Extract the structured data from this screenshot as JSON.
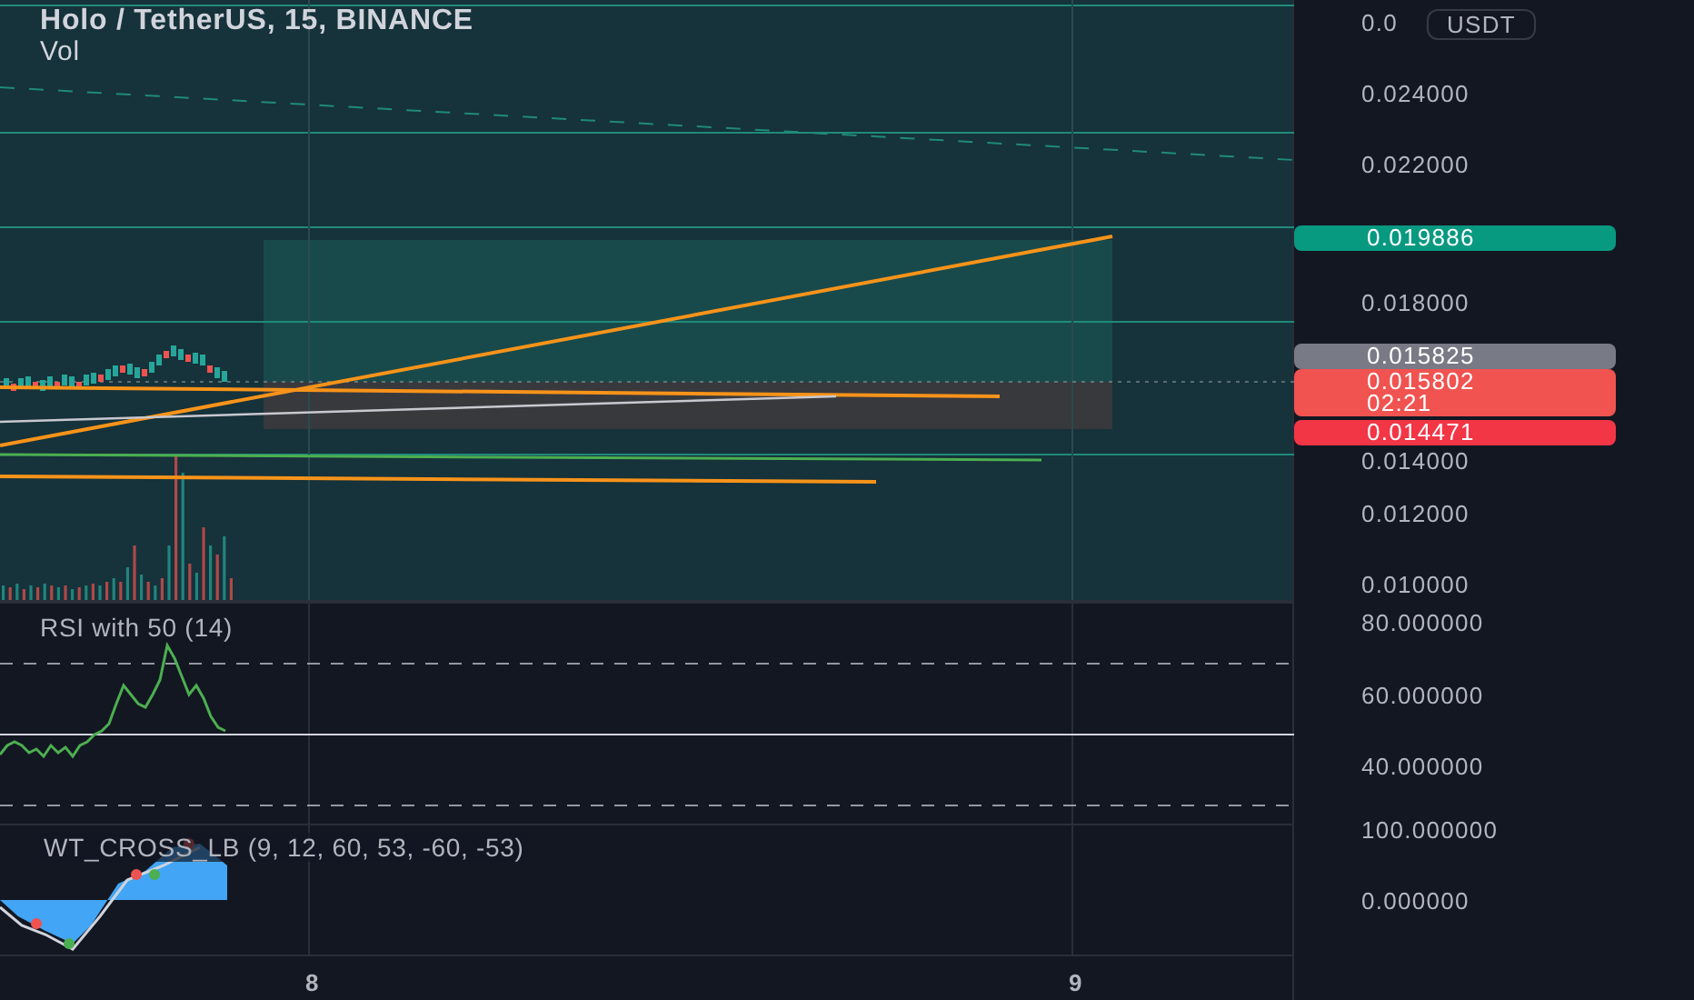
{
  "chart": {
    "title": "Holo / TetherUS, 15, BINANCE",
    "volume_label": "Vol"
  },
  "currency": "USDT",
  "price_axis": [
    {
      "label": "0.0",
      "kind": "tick"
    },
    {
      "label": "0.024000",
      "kind": "tick"
    },
    {
      "label": "0.022000",
      "kind": "tick"
    },
    {
      "label": "0.019886",
      "kind": "badge",
      "color": "#089981"
    },
    {
      "label": "0.018000",
      "kind": "tick"
    },
    {
      "label": "0.015825",
      "kind": "badge",
      "color": "#787b86"
    },
    {
      "label": "0.015802",
      "countdown": "02:21",
      "kind": "badge",
      "color": "#f05350"
    },
    {
      "label": "0.014471",
      "kind": "badge",
      "color": "#f23645"
    },
    {
      "label": "0.014000",
      "kind": "tick"
    },
    {
      "label": "0.012000",
      "kind": "tick"
    },
    {
      "label": "0.010000",
      "kind": "tick"
    }
  ],
  "rsi": {
    "title": "RSI with 50 (14)",
    "axis": [
      "80.000000",
      "60.000000",
      "40.000000"
    ]
  },
  "wt": {
    "title": "WT_CROSS_LB (9, 12, 60, 53, -60, -53)",
    "axis": [
      "100.000000",
      "0.000000"
    ]
  },
  "time_axis": [
    "8",
    "9"
  ]
}
